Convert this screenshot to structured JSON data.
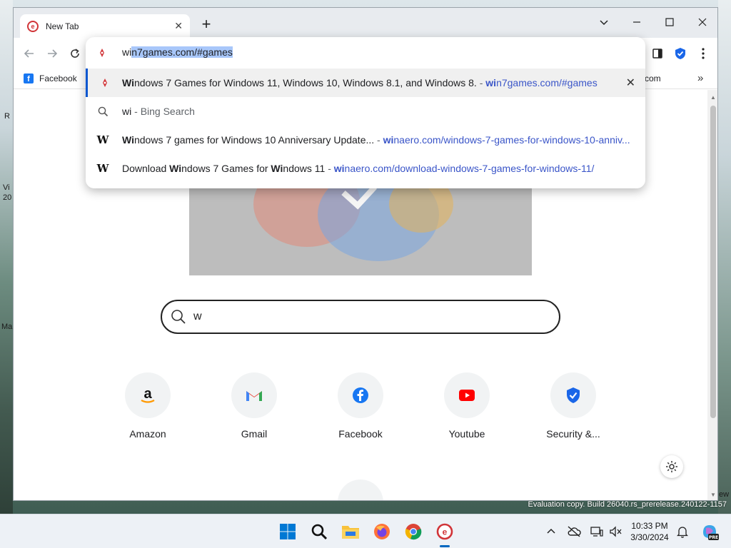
{
  "browser": {
    "tab_title": "New Tab",
    "bookmark_facebook": "Facebook",
    "bookmark_partial": "com",
    "more_bookmarks": "»"
  },
  "omnibox": {
    "text_prefix": "wi",
    "text_selected": "n7games.com/#games",
    "suggestions": [
      {
        "bold": "Wi",
        "title": "ndows 7 Games for Windows 11, Windows 10, Windows 8.1, and Windows 8.",
        "sep": " - ",
        "url_bold": "wi",
        "url": "n7games.com/#games",
        "icon": "win7games-favicon"
      },
      {
        "bold": "",
        "title": "wi",
        "sep": " - ",
        "url_bold": "",
        "url": "Bing Search",
        "icon": "search-icon"
      },
      {
        "bold": "Wi",
        "title": "ndows 7 games for Windows 10 Anniversary Update...",
        "sep": "  - ",
        "url_bold": "wi",
        "url": "naero.com/windows-7-games-for-windows-10-anniv...",
        "icon": "winaero-favicon"
      },
      {
        "pre": "Download ",
        "bold": "Wi",
        "title": "ndows 7 Games for ",
        "bold2": "Wi",
        "title2": "ndows 11",
        "sep": "  -  ",
        "url_bold": "wi",
        "url": "naero.com/download-windows-7-games-for-windows-11/",
        "icon": "winaero-favicon"
      }
    ]
  },
  "page": {
    "search_value": "w",
    "tiles": [
      {
        "label": "Amazon",
        "icon": "amazon-icon"
      },
      {
        "label": "Gmail",
        "icon": "gmail-icon"
      },
      {
        "label": "Facebook",
        "icon": "facebook-icon"
      },
      {
        "label": "Youtube",
        "icon": "youtube-icon"
      },
      {
        "label": "Security &...",
        "icon": "security-icon"
      }
    ]
  },
  "desktop": {
    "watermark": "Evaluation copy. Build 26040.rs_prerelease.240122-1157",
    "frag_left_1": "R",
    "frag_left_2": "Vi",
    "frag_left_3": "20",
    "frag_left_4": "Ma",
    "frag_right": "ew"
  },
  "taskbar": {
    "time": "10:33 PM",
    "date": "3/30/2024",
    "copilot_badge": "PRE"
  },
  "colors": {
    "accent": "#0b57d0",
    "url_blue": "#3a55c8",
    "selection": "#a8c7fa",
    "taskbar_bg": "#edf1f6"
  }
}
